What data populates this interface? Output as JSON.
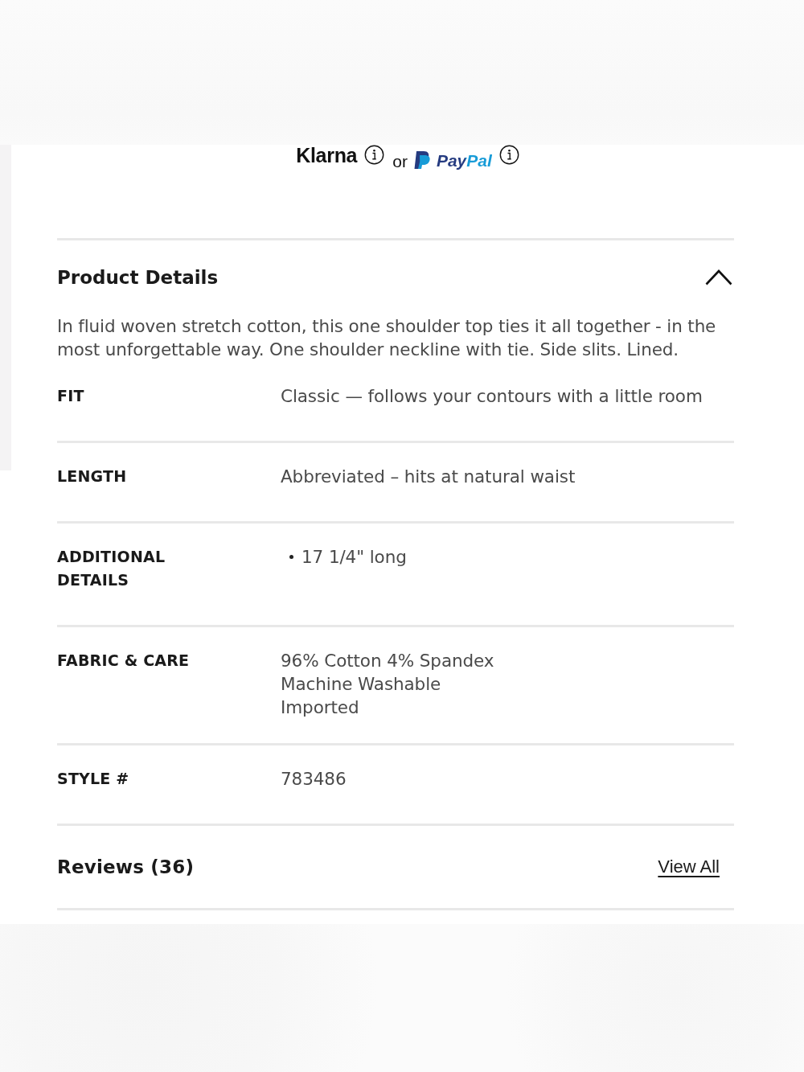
{
  "payment": {
    "klarna": "Klarna",
    "or": "or",
    "paypal": "PayPal"
  },
  "product_details": {
    "title": "Product Details",
    "expanded": true,
    "description": "In fluid woven stretch cotton, this one shoulder top ties it all together - in the most unforgettable way. One shoulder neckline with tie. Side slits. Lined.",
    "rows": [
      {
        "kind": "text",
        "label": "FIT",
        "value": "Classic — follows your contours with a little room"
      },
      {
        "kind": "text",
        "label": "LENGTH",
        "value": "Abbreviated – hits at natural waist"
      },
      {
        "kind": "bullets",
        "label": "ADDITIONAL DETAILS",
        "items": [
          "17 1/4\" long"
        ]
      },
      {
        "kind": "lines",
        "label": "FABRIC & CARE",
        "lines": [
          "96% Cotton 4% Spandex",
          "Machine Washable",
          "Imported"
        ]
      },
      {
        "kind": "text",
        "label": "STYLE #",
        "value": "783486"
      }
    ]
  },
  "reviews": {
    "title": "Reviews (36)",
    "link": "View All"
  }
}
